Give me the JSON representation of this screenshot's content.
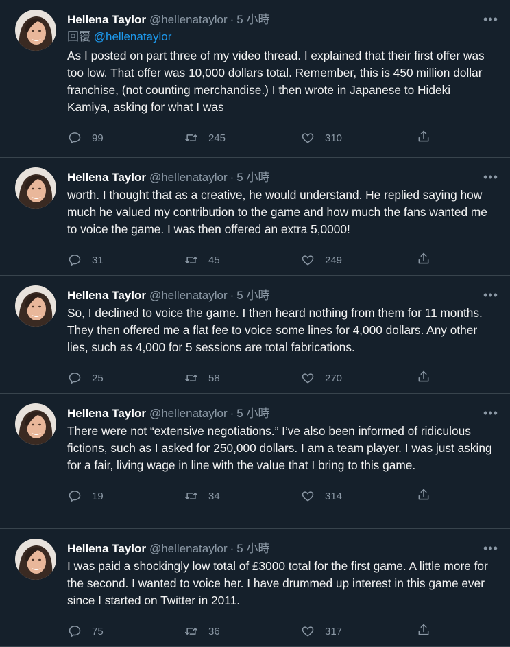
{
  "author": {
    "name": "Hellena Taylor",
    "handle": "@hellenataylor",
    "time": "5 小時"
  },
  "first_reply": {
    "label": "回覆",
    "mention": "@hellenataylor"
  },
  "tweets": [
    {
      "text": "As I posted on part three of my video thread.  I explained that their first offer was too low.  That offer was 10,000 dollars total.  Remember, this is 450 million dollar franchise, (not counting merchandise.)  I then wrote in Japanese to Hideki Kamiya, asking for what I was",
      "replies": "99",
      "retweets": "245",
      "likes": "310"
    },
    {
      "text": "worth.  I thought that as a creative, he would understand.  He replied saying how much he valued my contribution to the game and how much the fans wanted me to voice the game.  I was then offered an extra 5,0000!",
      "replies": "31",
      "retweets": "45",
      "likes": "249"
    },
    {
      "text": "So, I declined to voice the game.  I then heard nothing from them for 11 months.  They then offered me a flat fee to voice some lines for 4,000 dollars.  Any other lies, such as 4,000 for 5 sessions are total fabrications.",
      "replies": "25",
      "retweets": "58",
      "likes": "270"
    },
    {
      "text": "There were not “extensive negotiations.”  I’ve also been informed of ridiculous fictions, such as I asked for 250,000 dollars.  I am a team player.  I was just asking for a fair, living wage in line with the value that I bring to this game.",
      "replies": "19",
      "retweets": "34",
      "likes": "314"
    },
    {
      "text": "I was paid a shockingly low total of £3000 total for the first game.  A little more for the second.  I wanted to voice her.  I have drummed up interest in this game ever since I started on Twitter in 2011.",
      "replies": "75",
      "retweets": "36",
      "likes": "317"
    }
  ],
  "icons": {
    "more": "more-horizontal-icon",
    "reply": "reply-icon",
    "retweet": "retweet-icon",
    "like": "like-heart-icon",
    "share": "share-icon"
  },
  "colors": {
    "background": "#15202b",
    "text": "#f2f2f2",
    "muted": "#8b98a5",
    "accent": "#1d9bf0",
    "divider": "#38444d"
  }
}
